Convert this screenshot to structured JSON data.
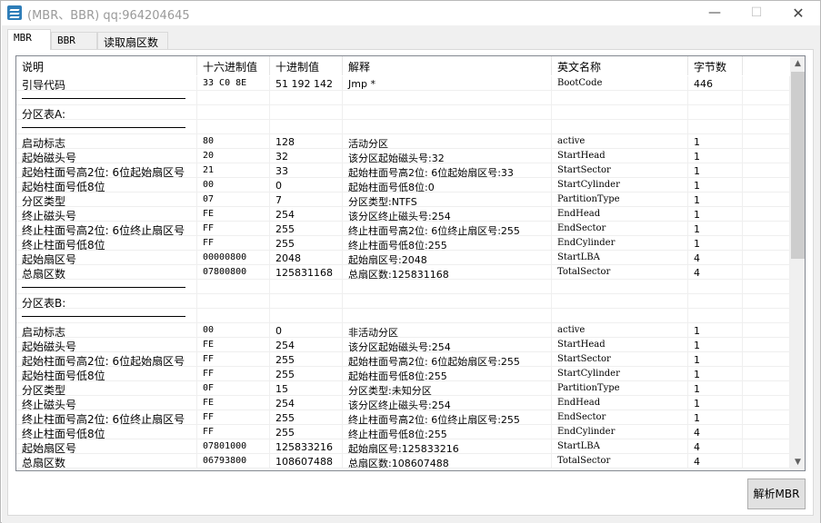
{
  "window": {
    "title": "(MBR、BBR)  qq:964204645",
    "min_glyph": "—",
    "max_glyph": "☐",
    "close_glyph": "✕"
  },
  "tabs": [
    {
      "label": "MBR",
      "active": true
    },
    {
      "label": "BBR",
      "active": false
    },
    {
      "label": "读取扇区数",
      "active": false
    }
  ],
  "table": {
    "columns": [
      "说明",
      "十六进制值",
      "十进制值",
      "解释",
      "英文名称",
      "字节数"
    ],
    "rows": [
      [
        "引导代码",
        "33 C0 8E",
        "51 192 142",
        "Jmp *",
        "BootCode",
        "446"
      ],
      [
        "---",
        "",
        "",
        "",
        "",
        ""
      ],
      [
        "分区表A:",
        "",
        "",
        "",
        "",
        ""
      ],
      [
        "---",
        "",
        "",
        "",
        "",
        ""
      ],
      [
        "启动标志",
        "80",
        "128",
        "活动分区",
        "active",
        "1"
      ],
      [
        "起始磁头号",
        "20",
        "32",
        "该分区起始磁头号:32",
        "StartHead",
        "1"
      ],
      [
        "起始柱面号高2位: 6位起始扇区号",
        "21",
        "33",
        "起始柱面号高2位: 6位起始扇区号:33",
        "StartSector",
        "1"
      ],
      [
        "起始柱面号低8位",
        "00",
        "0",
        "起始柱面号低8位:0",
        "StartCylinder",
        "1"
      ],
      [
        "分区类型",
        "07",
        "7",
        "分区类型:NTFS",
        "PartitionType",
        "1"
      ],
      [
        "终止磁头号",
        "FE",
        "254",
        "该分区终止磁头号:254",
        "EndHead",
        "1"
      ],
      [
        "终止柱面号高2位: 6位终止扇区号",
        "FF",
        "255",
        "终止柱面号高2位: 6位终止扇区号:255",
        "EndSector",
        "1"
      ],
      [
        "终止柱面号低8位",
        "FF",
        "255",
        "终止柱面号低8位:255",
        "EndCylinder",
        "1"
      ],
      [
        "起始扇区号",
        "00000800",
        "2048",
        "起始扇区号:2048",
        "StartLBA",
        "4"
      ],
      [
        "总扇区数",
        "07800800",
        "125831168",
        "总扇区数:125831168",
        "TotalSector",
        "4"
      ],
      [
        "---",
        "",
        "",
        "",
        "",
        ""
      ],
      [
        "分区表B:",
        "",
        "",
        "",
        "",
        ""
      ],
      [
        "---",
        "",
        "",
        "",
        "",
        ""
      ],
      [
        "启动标志",
        "00",
        "0",
        "非活动分区",
        "active",
        "1"
      ],
      [
        "起始磁头号",
        "FE",
        "254",
        "该分区起始磁头号:254",
        "StartHead",
        "1"
      ],
      [
        "起始柱面号高2位: 6位起始扇区号",
        "FF",
        "255",
        "起始柱面号高2位: 6位起始扇区号:255",
        "StartSector",
        "1"
      ],
      [
        "起始柱面号低8位",
        "FF",
        "255",
        "起始柱面号低8位:255",
        "StartCylinder",
        "1"
      ],
      [
        "分区类型",
        "0F",
        "15",
        "分区类型:未知分区",
        "PartitionType",
        "1"
      ],
      [
        "终止磁头号",
        "FE",
        "254",
        "该分区终止磁头号:254",
        "EndHead",
        "1"
      ],
      [
        "终止柱面号高2位: 6位终止扇区号",
        "FF",
        "255",
        "终止柱面号高2位: 6位终止扇区号:255",
        "EndSector",
        "1"
      ],
      [
        "终止柱面号低8位",
        "FF",
        "255",
        "终止柱面号低8位:255",
        "EndCylinder",
        "4"
      ],
      [
        "起始扇区号",
        "07801000",
        "125833216",
        "起始扇区号:125833216",
        "StartLBA",
        "4"
      ],
      [
        "总扇区数",
        "06793800",
        "108607488",
        "总扇区数:108607488",
        "TotalSector",
        "4"
      ]
    ]
  },
  "scrollbar": {
    "up_glyph": "▲",
    "down_glyph": "▼"
  },
  "buttons": {
    "parse_mbr": "解析MBR"
  }
}
